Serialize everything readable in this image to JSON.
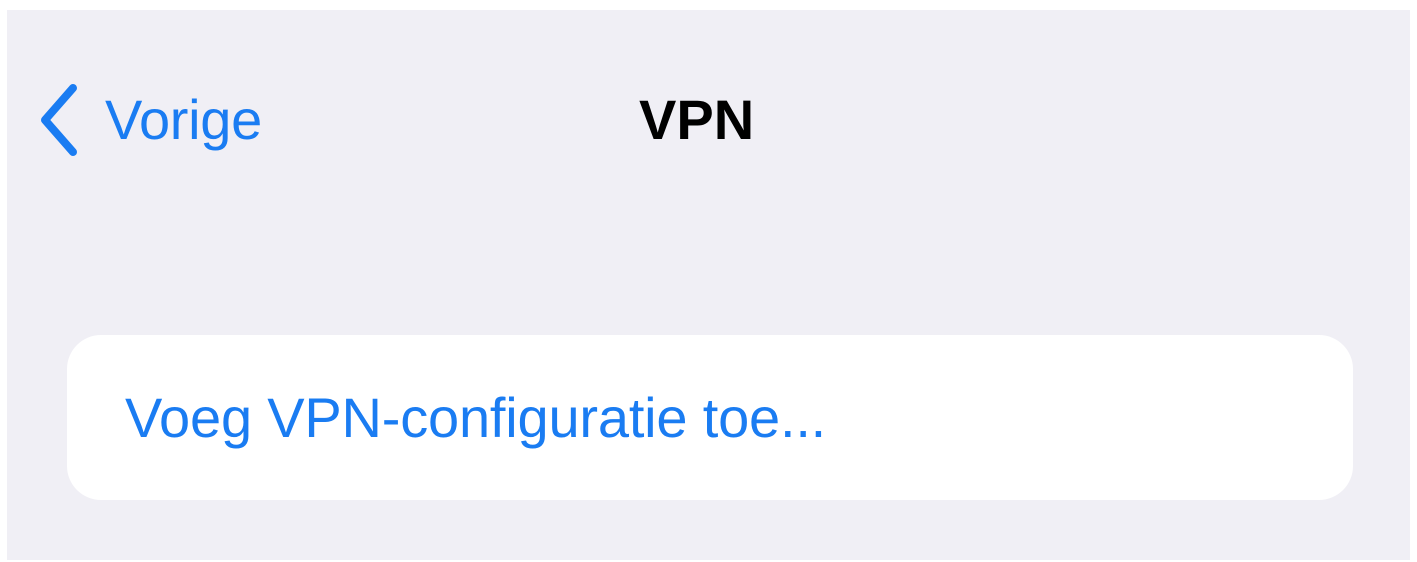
{
  "nav": {
    "back_label": "Vorige",
    "title": "VPN"
  },
  "vpn_group": {
    "add_configuration_label": "Voeg VPN-configuratie toe..."
  },
  "icons": {
    "back": "chevron-left-icon"
  },
  "colors": {
    "accent": "#1a7cf2",
    "background": "#f0eff5",
    "card": "#ffffff",
    "title": "#000000"
  }
}
